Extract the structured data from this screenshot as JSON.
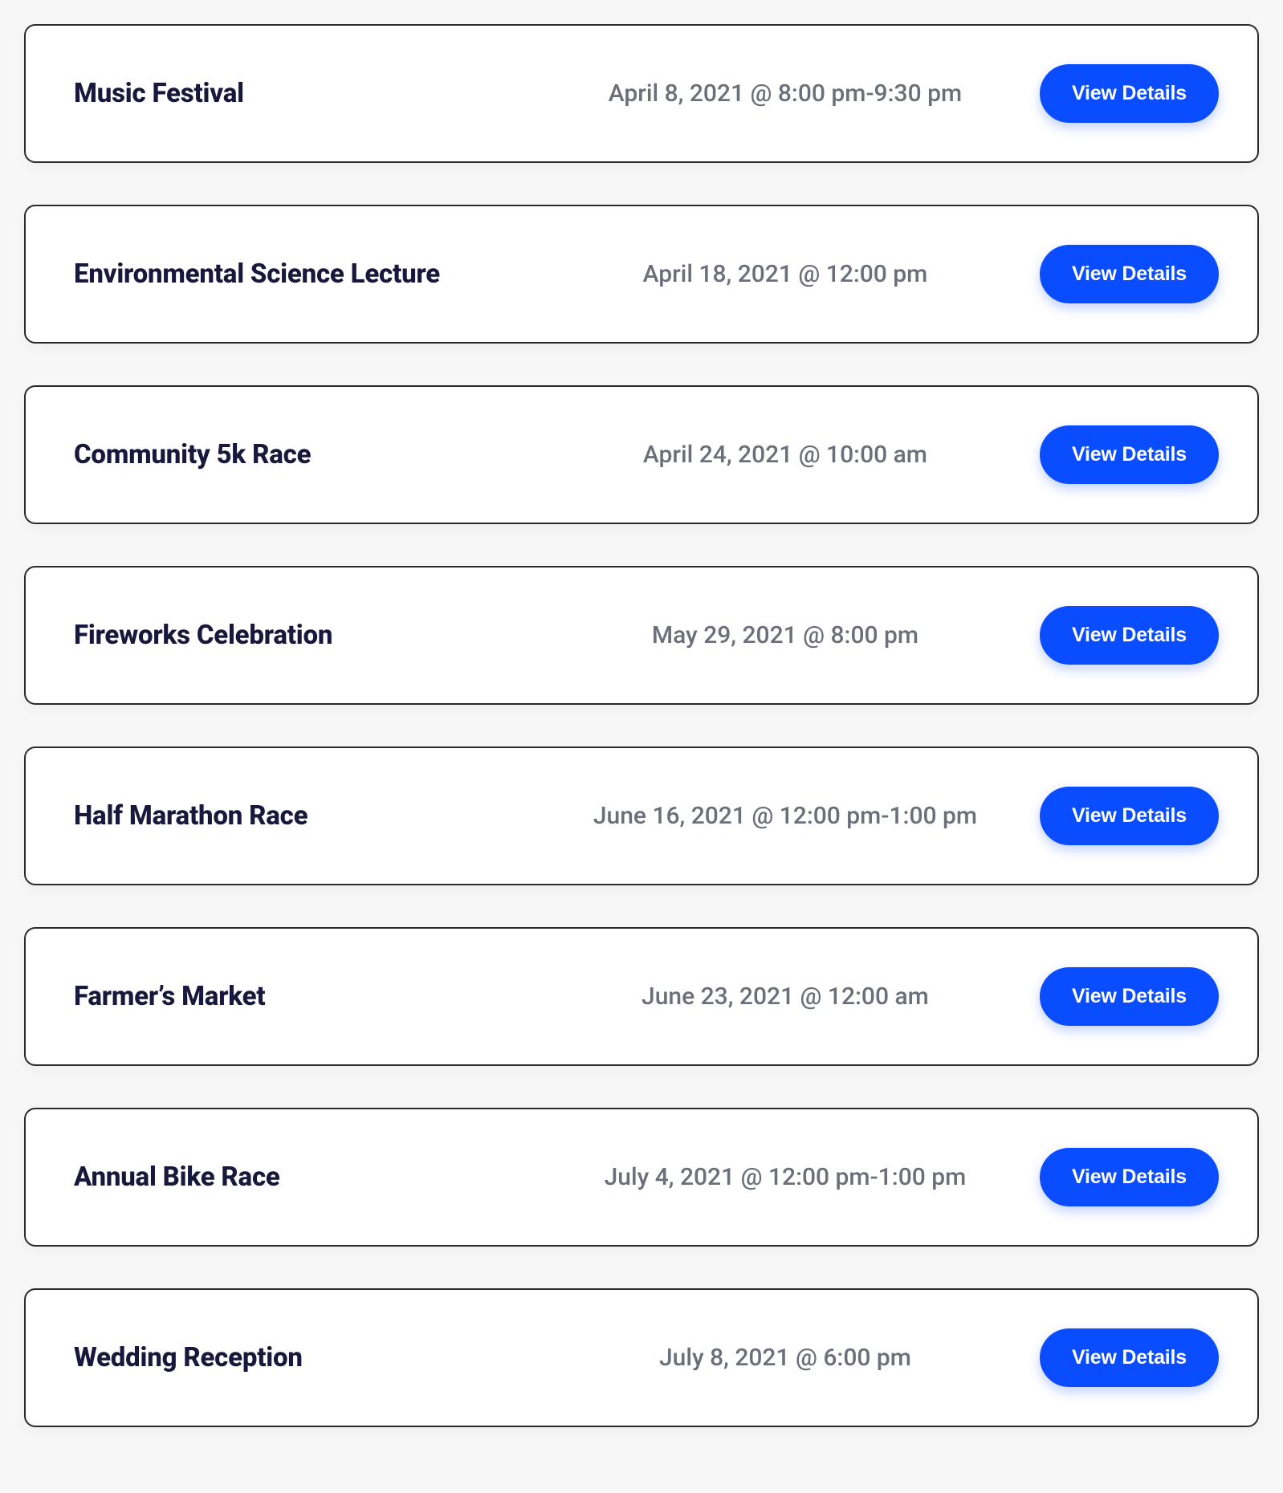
{
  "button_label": "View Details",
  "events": [
    {
      "title": "Music Festival",
      "date": "April 8, 2021 @ 8:00 pm-9:30 pm"
    },
    {
      "title": "Environmental Science Lecture",
      "date": "April 18, 2021 @ 12:00 pm"
    },
    {
      "title": "Community 5k Race",
      "date": "April 24, 2021 @ 10:00 am"
    },
    {
      "title": "Fireworks Celebration",
      "date": "May 29, 2021 @ 8:00 pm"
    },
    {
      "title": "Half Marathon Race",
      "date": "June 16, 2021 @ 12:00 pm-1:00 pm"
    },
    {
      "title": "Farmer’s Market",
      "date": "June 23, 2021 @ 12:00 am"
    },
    {
      "title": "Annual Bike Race",
      "date": "July 4, 2021 @ 12:00 pm-1:00 pm"
    },
    {
      "title": "Wedding Reception",
      "date": "July 8, 2021 @ 6:00 pm"
    }
  ]
}
